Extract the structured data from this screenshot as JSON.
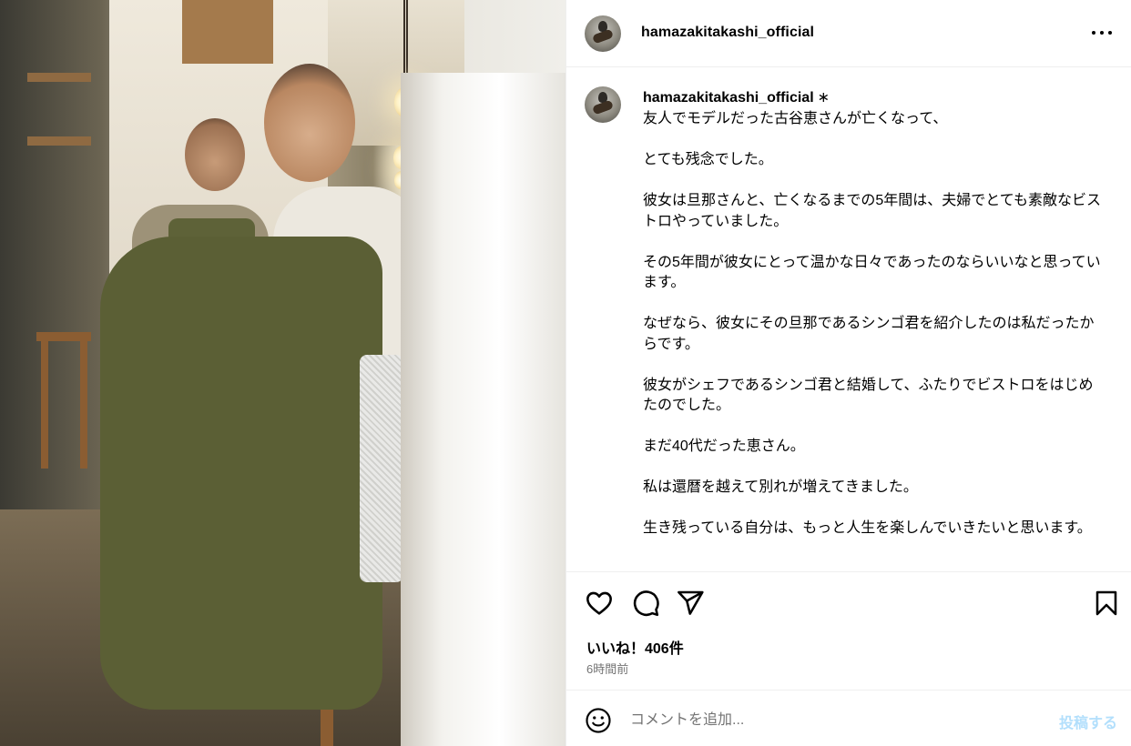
{
  "post": {
    "author": "hamazakitakashi_official",
    "author_mark": "∗",
    "caption": "友人でモデルだった古谷恵さんが亡くなって、\n\nとても残念でした。\n\n彼女は旦那さんと、亡くなるまでの5年間は、夫婦でとても素敵なビストロやっていました。\n\nその5年間が彼女にとって温かな日々であったのならいいなと思っています。\n\nなぜなら、彼女にその旦那であるシンゴ君を紹介したのは私だったからです。\n\n彼女がシェフであるシンゴ君と結婚して、ふたりでビストロをはじめたのでした。\n\nまだ40代だった恵さん。\n\n私は還暦を越えて別れが増えてきました。\n\n生き残っている自分は、もっと人生を楽しんでいきたいと思います。",
    "likes": "いいね！406件",
    "time": "6時間前"
  },
  "actions": {
    "like_icon": "heart-icon",
    "comment_icon": "comment-icon",
    "share_icon": "paper-plane-icon",
    "save_icon": "bookmark-icon",
    "more_icon": "ellipsis-icon"
  },
  "composer": {
    "placeholder": "コメントを追加...",
    "post_label": "投稿する",
    "emoji_icon": "emoji-smile-icon"
  },
  "colors": {
    "post_button": "#b2dffc",
    "muted_text": "#737373",
    "divider": "#efefef"
  }
}
